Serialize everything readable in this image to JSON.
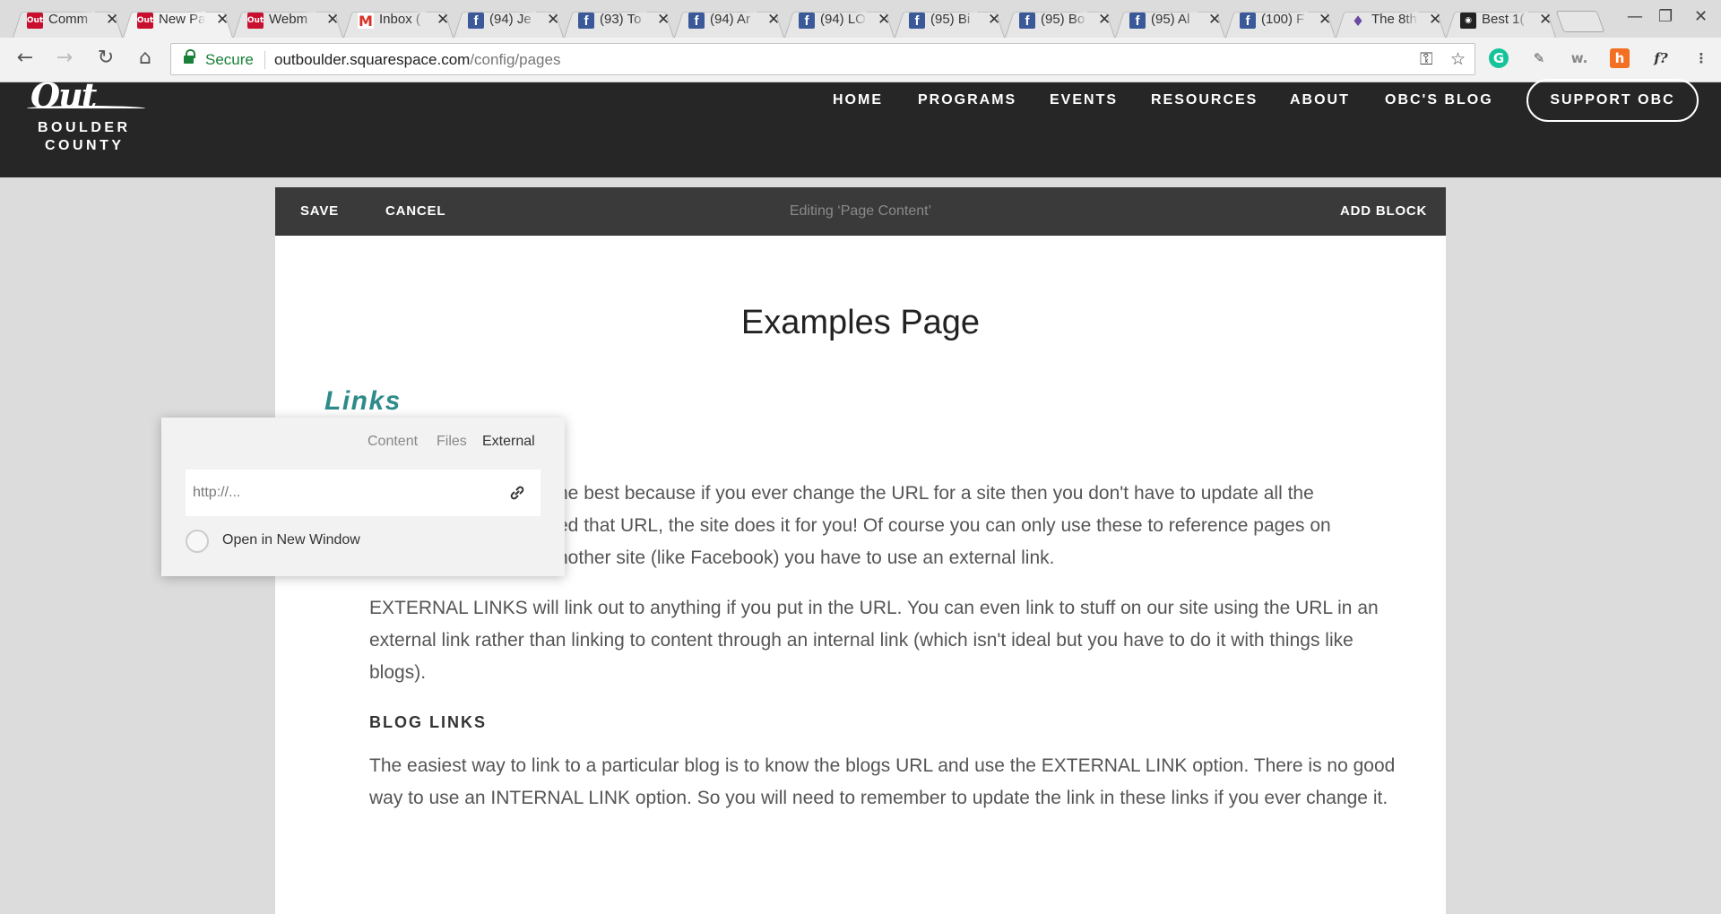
{
  "browser": {
    "tabs": [
      {
        "title": "Comm",
        "icon": "obc-favicon"
      },
      {
        "title": "New Pa",
        "icon": "obc-favicon",
        "active": true
      },
      {
        "title": "Webm",
        "icon": "obc-favicon"
      },
      {
        "title": "Inbox (",
        "icon": "gmail-favicon"
      },
      {
        "title": "(94) Je",
        "icon": "facebook-favicon"
      },
      {
        "title": "(93) To",
        "icon": "facebook-favicon"
      },
      {
        "title": "(94) Ar",
        "icon": "facebook-favicon"
      },
      {
        "title": "(94) LO",
        "icon": "facebook-favicon"
      },
      {
        "title": "(95) Bi",
        "icon": "facebook-favicon"
      },
      {
        "title": "(95) Bo",
        "icon": "facebook-favicon"
      },
      {
        "title": "(95) Al",
        "icon": "facebook-favicon"
      },
      {
        "title": "(100) F",
        "icon": "facebook-favicon"
      },
      {
        "title": "The 8th",
        "icon": "theatre-favicon"
      },
      {
        "title": "Best 1(",
        "icon": "camera-favicon"
      }
    ],
    "address": {
      "secure_label": "Secure",
      "host": "outboulder.squarespace.com",
      "path": "/config/pages"
    }
  },
  "site": {
    "logo": {
      "line1": "BOULDER",
      "line2": "COUNTY",
      "mark": "Out"
    },
    "nav": [
      "HOME",
      "PROGRAMS",
      "EVENTS",
      "RESOURCES",
      "ABOUT",
      "OBC'S BLOG"
    ],
    "cta": "SUPPORT OBC"
  },
  "editor": {
    "save": "SAVE",
    "cancel": "CANCEL",
    "title": "Editing ‘Page Content’",
    "add_block": "ADD BLOCK"
  },
  "content": {
    "page_title": "Examples Page",
    "section_heading": "Links",
    "para1_line1": "he best because if you ever change the URL for a site then you don't have to update all the",
    "para1_line2": "ed that URL, the site does it for you! Of course you can only use these to reference pages on",
    "para1_line3": "nother site (like Facebook) you have to use an external link.",
    "para2": "EXTERNAL LINKS will link out to anything if you put in the URL. You can even link to stuff on our site using the URL in an external link rather than linking to content through an internal link (which isn't ideal but you have to do it with things like blogs).",
    "blog_heading": "BLOG LINKS",
    "para3": "The easiest way to link to a particular blog is to know the blogs URL and use the EXTERNAL LINK option. There is no good way to use an INTERNAL LINK option. So you will need to remember to update the link in these links if you ever change it."
  },
  "link_popup": {
    "tabs": [
      "Content",
      "Files",
      "External"
    ],
    "active_tab": "External",
    "url_placeholder": "http://...",
    "url_value": "",
    "new_window_label": "Open in New Window",
    "new_window_checked": false
  },
  "colors": {
    "header_bg": "#262626",
    "editor_bar_bg": "#3a3a3a",
    "section_heading": "#2e8b8b",
    "secure_green": "#188038"
  }
}
